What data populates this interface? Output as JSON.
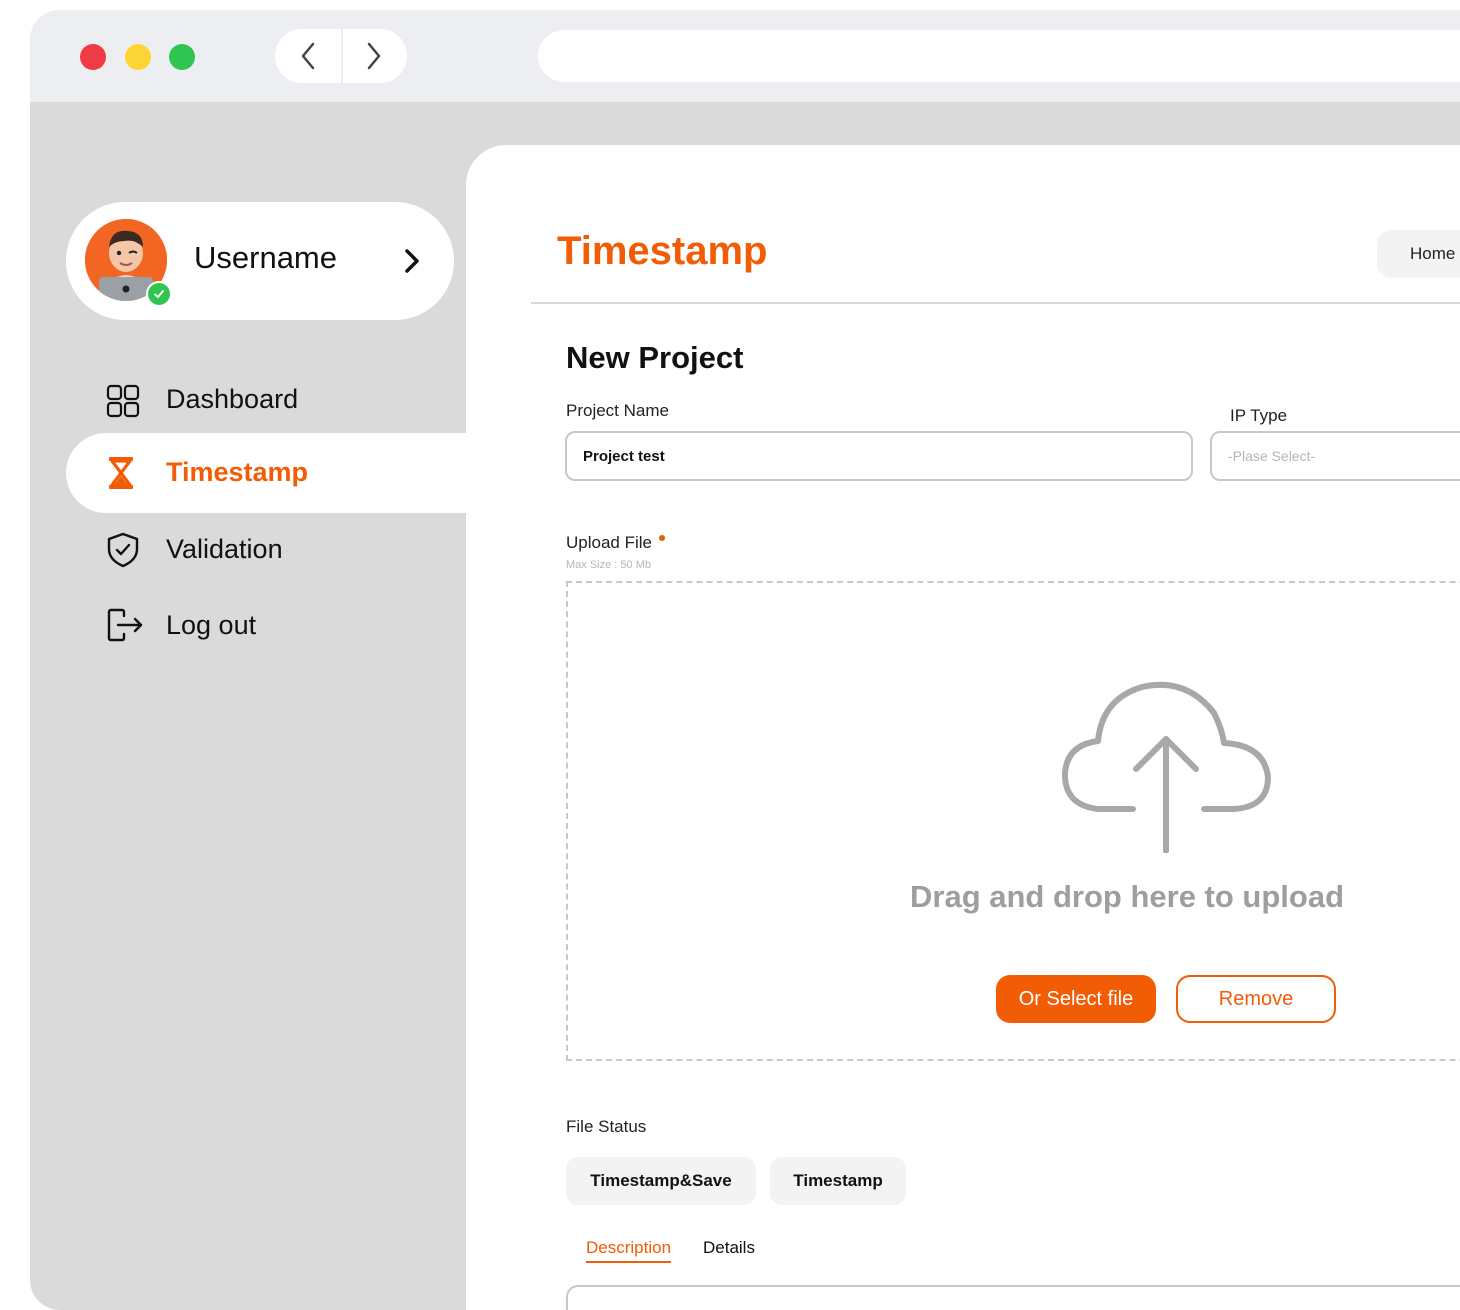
{
  "browser": {
    "window_controls": [
      "close",
      "minimize",
      "maximize"
    ],
    "nav": {
      "back_icon": "chevron-left-icon",
      "forward_icon": "chevron-right-icon"
    },
    "url": ""
  },
  "sidebar": {
    "user": {
      "name": "Username",
      "status": "online"
    },
    "items": [
      {
        "label": "Dashboard",
        "icon": "grid-icon",
        "active": false
      },
      {
        "label": "Timestamp",
        "icon": "hourglass-icon",
        "active": true
      },
      {
        "label": "Validation",
        "icon": "shield-check-icon",
        "active": false
      },
      {
        "label": "Log out",
        "icon": "logout-icon",
        "active": false
      }
    ]
  },
  "header": {
    "title": "Timestamp",
    "breadcrumb": "Home"
  },
  "form": {
    "section_title": "New Project",
    "project_name": {
      "label": "Project Name",
      "value": "Project test"
    },
    "ip_type": {
      "label": "IP Type",
      "placeholder": "-Plase Select-"
    },
    "upload": {
      "label": "Upload  File",
      "max_size": "Max Size : 50 Mb",
      "drop_text": "Drag and drop here to upload",
      "select_button": "Or Select file",
      "remove_button": "Remove"
    },
    "file_status": {
      "label": "File Status",
      "options": [
        "Timestamp&Save",
        "Timestamp"
      ]
    },
    "tabs": [
      "Description",
      "Details"
    ],
    "active_tab": "Description"
  },
  "colors": {
    "accent": "#f25c05",
    "sidebar_bg": "#dadada",
    "titlebar_bg": "#edeef1",
    "online": "#2fc551"
  }
}
